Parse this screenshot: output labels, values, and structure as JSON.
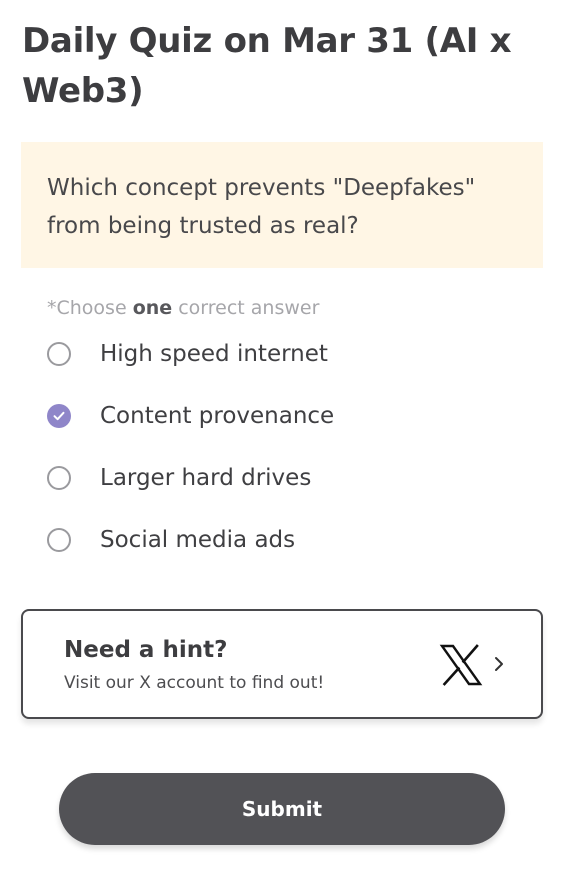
{
  "title": "Daily Quiz on Mar 31 (AI x Web3)",
  "question": "Which concept prevents \"Deepfakes\"\nfrom being trusted as real?",
  "instruction": {
    "prefix": "*Choose ",
    "emphasis": "one",
    "suffix": " correct answer"
  },
  "options": [
    {
      "label": "High speed internet",
      "selected": false
    },
    {
      "label": "Content provenance",
      "selected": true
    },
    {
      "label": "Larger hard drives",
      "selected": false
    },
    {
      "label": "Social media ads",
      "selected": false
    }
  ],
  "hint": {
    "title": "Need a hint?",
    "subtitle": "Visit our X account to find out!",
    "logo_icon": "x-logo-icon",
    "arrow_icon": "chevron-right-icon"
  },
  "submit_label": "Submit",
  "colors": {
    "accent": "#8f86c9",
    "question_bg": "#fff6e5",
    "button_bg": "#525256"
  }
}
